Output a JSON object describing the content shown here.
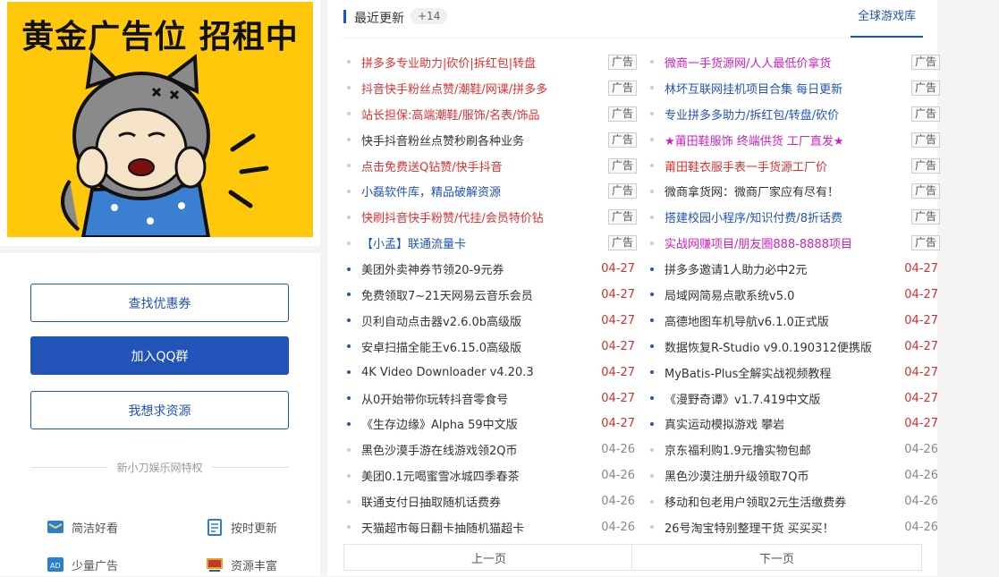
{
  "ad": {
    "banner_text": "黄金广告位 招租中"
  },
  "panel": {
    "btn_coupon": "查找优惠券",
    "btn_qq": "加入QQ群",
    "btn_request": "我想求资源",
    "divider": "新小刀娱乐网特权",
    "features": [
      {
        "label": "简洁好看",
        "icon": "clean-icon"
      },
      {
        "label": "按时更新",
        "icon": "update-icon"
      },
      {
        "label": "少量广告",
        "icon": "ad-icon"
      },
      {
        "label": "资源丰富",
        "icon": "resource-icon"
      }
    ]
  },
  "header": {
    "title": "最近更新",
    "count": "+14",
    "link": "全球游戏库"
  },
  "colors": {
    "red": "#e03030",
    "blue": "#2153b8",
    "magenta": "#d020c0",
    "accent": "#2153b8"
  },
  "list_left": [
    {
      "text": "拼多多专业助力|砍价|拆红包|转盘",
      "color": "red",
      "tag": "广告"
    },
    {
      "text": "抖音快手粉丝点赞/潮鞋/网课/拼多多",
      "color": "red",
      "tag": "广告"
    },
    {
      "text": "站长担保:高端潮鞋/服饰/名表/饰品",
      "color": "red",
      "tag": "广告"
    },
    {
      "text": "快手抖音粉丝点赞秒刷各种业务",
      "color": "dark",
      "tag": "广告"
    },
    {
      "text": "点击免费送Q钻赞/快手抖音",
      "color": "red",
      "tag": "广告"
    },
    {
      "text": "小磊软件库，精品破解资源",
      "color": "blue",
      "tag": "广告"
    },
    {
      "text": "快刷抖音快手粉赞/代挂/会员特价钻",
      "color": "red",
      "tag": "广告"
    },
    {
      "text": "【小孟】联通流量卡",
      "color": "blue",
      "tag": "广告"
    },
    {
      "text": "美团外卖神券节领20-9元券",
      "date": "04-27"
    },
    {
      "text": "免费领取7~21天网易云音乐会员",
      "date": "04-27"
    },
    {
      "text": "贝利自动点击器v2.6.0b高级版",
      "date": "04-27"
    },
    {
      "text": "安卓扫描全能王v6.15.0高级版",
      "date": "04-27"
    },
    {
      "text": "4K Video Downloader v4.20.3",
      "date": "04-27"
    },
    {
      "text": "从0开始带你玩转抖音零食号",
      "date": "04-27"
    },
    {
      "text": "《生存边缘》Alpha 59中文版",
      "date": "04-27"
    },
    {
      "text": "黑色沙漠手游在线游戏领2Q币",
      "date": "04-26"
    },
    {
      "text": "美团0.1元喝蜜雪冰城四季春茶",
      "date": "04-26"
    },
    {
      "text": "联通支付日抽取随机话费券",
      "date": "04-26"
    },
    {
      "text": "天猫超市每日翻卡抽随机猫超卡",
      "date": "04-26"
    }
  ],
  "list_right": [
    {
      "text": "微商一手货源网/人人最低价拿货",
      "color": "magenta",
      "tag": "广告"
    },
    {
      "text": "林坏互联网挂机项目合集 每日更新",
      "color": "blue",
      "tag": "广告"
    },
    {
      "text": "专业拼多多助力/拆红包/转盘/砍价",
      "color": "blue",
      "tag": "广告"
    },
    {
      "text": "★莆田鞋服饰 终端供货 工厂直发★",
      "color": "magenta",
      "tag": "广告"
    },
    {
      "text": "莆田鞋衣服手表一手货源工厂价",
      "color": "red",
      "tag": "广告"
    },
    {
      "text": "微商拿货网：微商厂家应有尽有！",
      "color": "dark",
      "tag": "广告"
    },
    {
      "text": "搭建校园小程序/知识付费/8折话费",
      "color": "blue",
      "tag": "广告"
    },
    {
      "text": "实战网赚项目/朋友圈888-8888项目",
      "color": "magenta",
      "tag": "广告"
    },
    {
      "text": "拼多多邀请1人助力必中2元",
      "date": "04-27"
    },
    {
      "text": "局域网简易点歌系统v5.0",
      "date": "04-27"
    },
    {
      "text": "高德地图车机导航v6.1.0正式版",
      "date": "04-27"
    },
    {
      "text": "数据恢复R-Studio v9.0.190312便携版",
      "date": "04-27"
    },
    {
      "text": "MyBatis-Plus全解实战视频教程",
      "date": "04-27"
    },
    {
      "text": "《漫野奇谭》v1.7.419中文版",
      "date": "04-27"
    },
    {
      "text": "真实运动模拟游戏 攀岩",
      "date": "04-27"
    },
    {
      "text": "京东福利购1.9元撸实物包邮",
      "date": "04-26"
    },
    {
      "text": "黑色沙漠注册升级领取7Q币",
      "date": "04-26"
    },
    {
      "text": "移动和包老用户领取2元生活缴费券",
      "date": "04-26"
    },
    {
      "text": "26号淘宝特别整理干货 买买买！",
      "date": "04-26"
    }
  ],
  "pager": {
    "prev": "上一页",
    "next": "下一页"
  }
}
